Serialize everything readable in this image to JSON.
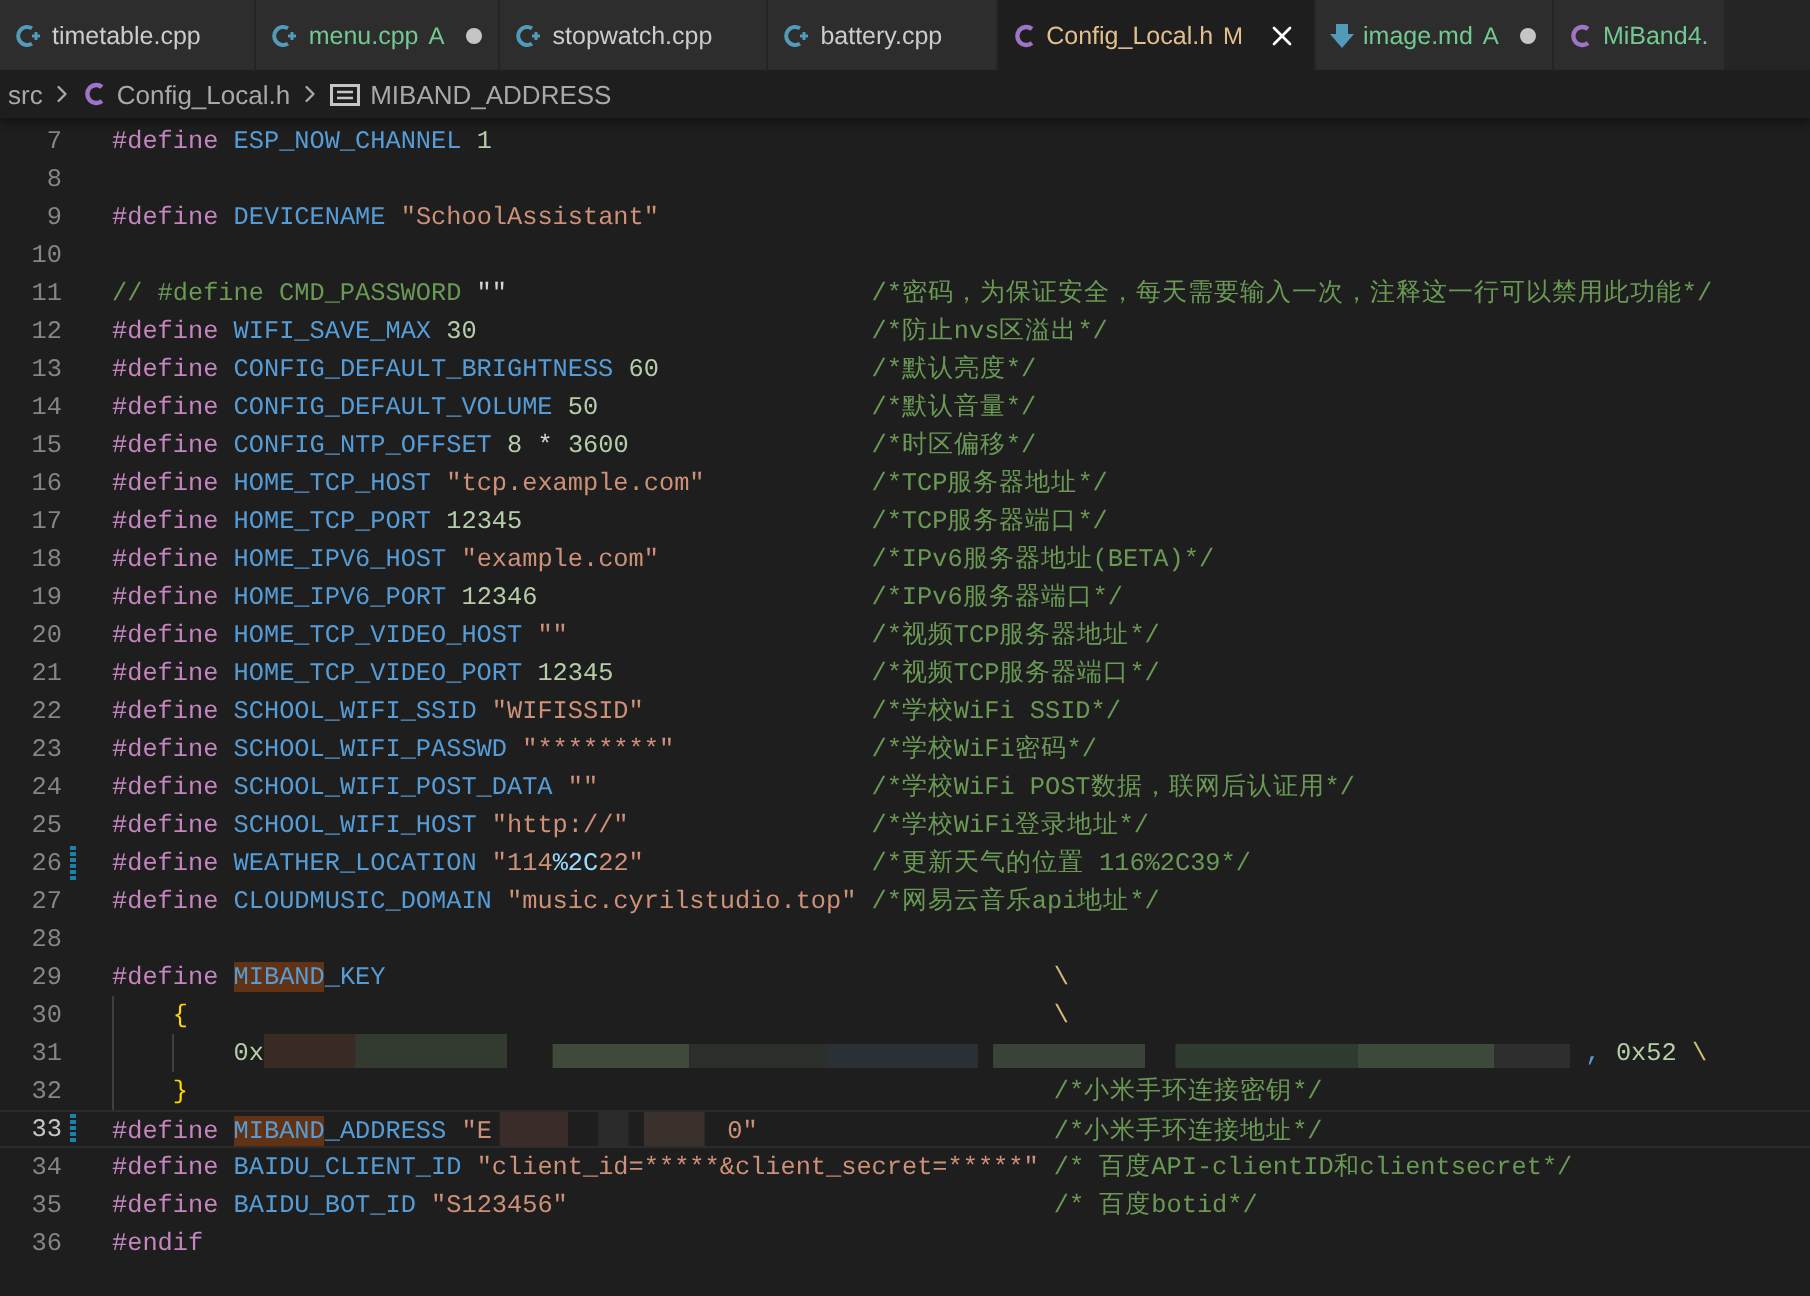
{
  "tabs": [
    {
      "label": "timetable.cpp",
      "kind": "cpp",
      "color": "#cccccc",
      "selected": false,
      "dirty": false
    },
    {
      "label": "menu.cpp",
      "kind": "cpp",
      "badge": "A",
      "color": "#73c991",
      "selected": false,
      "dirty": true
    },
    {
      "label": "stopwatch.cpp",
      "kind": "cpp",
      "color": "#cccccc",
      "selected": false,
      "dirty": false
    },
    {
      "label": "battery.cpp",
      "kind": "cpp",
      "color": "#cccccc",
      "selected": false,
      "dirty": false
    },
    {
      "label": "Config_Local.h",
      "kind": "c",
      "badge": "M",
      "color": "#e2c08d",
      "selected": true,
      "dirty": false
    },
    {
      "label": "image.md",
      "kind": "md",
      "badge": "A",
      "color": "#73c991",
      "selected": false,
      "dirty": true
    },
    {
      "label": "MiBand4.",
      "kind": "c",
      "color": "#73c991",
      "selected": false,
      "dirty": false
    }
  ],
  "breadcrumbs": [
    {
      "label": "src",
      "kind": "folder"
    },
    {
      "label": "Config_Local.h",
      "kind": "c"
    },
    {
      "label": "MIBAND_ADDRESS",
      "kind": "symbol"
    }
  ],
  "lines": [
    {
      "n": "7",
      "current": false,
      "modified": false,
      "code": [
        [
          {
            "kind": "kw",
            "text": "#define"
          }
        ],
        [
          {
            "kind": "macro",
            "text": "ESP_NOW_CHANNEL"
          }
        ],
        [
          {
            "kind": "num",
            "text": "1"
          }
        ]
      ]
    },
    {
      "n": "8",
      "current": false,
      "modified": false
    },
    {
      "n": "9",
      "current": false,
      "modified": false,
      "code": [
        [
          {
            "kind": "kw",
            "text": "#define"
          }
        ],
        [
          {
            "kind": "macro",
            "text": "DEVICENAME"
          }
        ],
        [
          {
            "kind": "str",
            "text": "\"SchoolAssistant\""
          }
        ]
      ]
    },
    {
      "n": "10",
      "current": false,
      "modified": false
    },
    {
      "n": "11",
      "current": false,
      "modified": false,
      "code": [
        [
          {
            "kind": "comment",
            "text": "// #define CMD_PASSWORD"
          }
        ],
        [
          {
            "kind": "plain",
            "text": "\"\""
          }
        ]
      ],
      "trailer": {
        "kind": "comment",
        "text": "/*密码，为保证安全，每天需要输入一次，注释这一行可以禁用此功能*/"
      }
    },
    {
      "n": "12",
      "current": false,
      "modified": false,
      "code": [
        [
          {
            "kind": "kw",
            "text": "#define"
          }
        ],
        [
          {
            "kind": "macro",
            "text": "WIFI_SAVE_MAX"
          }
        ],
        [
          {
            "kind": "num",
            "text": "30"
          }
        ]
      ],
      "trailer": {
        "kind": "comment",
        "text": "/*防止nvs区溢出*/"
      }
    },
    {
      "n": "13",
      "current": false,
      "modified": false,
      "code": [
        [
          {
            "kind": "kw",
            "text": "#define"
          }
        ],
        [
          {
            "kind": "macro",
            "text": "CONFIG_DEFAULT_BRIGHTNESS"
          }
        ],
        [
          {
            "kind": "num",
            "text": "60"
          }
        ]
      ],
      "trailer": {
        "kind": "comment",
        "text": "/*默认亮度*/"
      }
    },
    {
      "n": "14",
      "current": false,
      "modified": false,
      "code": [
        [
          {
            "kind": "kw",
            "text": "#define"
          }
        ],
        [
          {
            "kind": "macro",
            "text": "CONFIG_DEFAULT_VOLUME"
          }
        ],
        [
          {
            "kind": "num",
            "text": "50"
          }
        ]
      ],
      "trailer": {
        "kind": "comment",
        "text": "/*默认音量*/"
      }
    },
    {
      "n": "15",
      "current": false,
      "modified": false,
      "code": [
        [
          {
            "kind": "kw",
            "text": "#define"
          }
        ],
        [
          {
            "kind": "macro",
            "text": "CONFIG_NTP_OFFSET"
          }
        ],
        [
          {
            "kind": "num",
            "text": "8"
          }
        ],
        [
          {
            "kind": "op",
            "text": "*"
          }
        ],
        [
          {
            "kind": "num",
            "text": "3600"
          }
        ]
      ],
      "trailer": {
        "kind": "comment",
        "text": "/*时区偏移*/"
      }
    },
    {
      "n": "16",
      "current": false,
      "modified": false,
      "code": [
        [
          {
            "kind": "kw",
            "text": "#define"
          }
        ],
        [
          {
            "kind": "macro",
            "text": "HOME_TCP_HOST"
          }
        ],
        [
          {
            "kind": "str",
            "text": "\"tcp.example.com\""
          }
        ]
      ],
      "trailer": {
        "kind": "comment",
        "text": "/*TCP服务器地址*/"
      }
    },
    {
      "n": "17",
      "current": false,
      "modified": false,
      "code": [
        [
          {
            "kind": "kw",
            "text": "#define"
          }
        ],
        [
          {
            "kind": "macro",
            "text": "HOME_TCP_PORT"
          }
        ],
        [
          {
            "kind": "num",
            "text": "12345"
          }
        ]
      ],
      "trailer": {
        "kind": "comment",
        "text": "/*TCP服务器端口*/"
      }
    },
    {
      "n": "18",
      "current": false,
      "modified": false,
      "code": [
        [
          {
            "kind": "kw",
            "text": "#define"
          }
        ],
        [
          {
            "kind": "macro",
            "text": "HOME_IPV6_HOST"
          }
        ],
        [
          {
            "kind": "str",
            "text": "\"example.com\""
          }
        ]
      ],
      "trailer": {
        "kind": "comment",
        "text": "/*IPv6服务器地址(BETA)*/"
      }
    },
    {
      "n": "19",
      "current": false,
      "modified": false,
      "code": [
        [
          {
            "kind": "kw",
            "text": "#define"
          }
        ],
        [
          {
            "kind": "macro",
            "text": "HOME_IPV6_PORT"
          }
        ],
        [
          {
            "kind": "num",
            "text": "12346"
          }
        ]
      ],
      "trailer": {
        "kind": "comment",
        "text": "/*IPv6服务器端口*/"
      }
    },
    {
      "n": "20",
      "current": false,
      "modified": false,
      "code": [
        [
          {
            "kind": "kw",
            "text": "#define"
          }
        ],
        [
          {
            "kind": "macro",
            "text": "HOME_TCP_VIDEO_HOST"
          }
        ],
        [
          {
            "kind": "str",
            "text": "\"\""
          }
        ]
      ],
      "trailer": {
        "kind": "comment",
        "text": "/*视频TCP服务器地址*/"
      }
    },
    {
      "n": "21",
      "current": false,
      "modified": false,
      "code": [
        [
          {
            "kind": "kw",
            "text": "#define"
          }
        ],
        [
          {
            "kind": "macro",
            "text": "HOME_TCP_VIDEO_PORT"
          }
        ],
        [
          {
            "kind": "num",
            "text": "12345"
          }
        ]
      ],
      "trailer": {
        "kind": "comment",
        "text": "/*视频TCP服务器端口*/"
      }
    },
    {
      "n": "22",
      "current": false,
      "modified": false,
      "code": [
        [
          {
            "kind": "kw",
            "text": "#define"
          }
        ],
        [
          {
            "kind": "macro",
            "text": "SCHOOL_WIFI_SSID"
          }
        ],
        [
          {
            "kind": "str",
            "text": "\"WIFISSID\""
          }
        ]
      ],
      "trailer": {
        "kind": "comment",
        "text": "/*学校WiFi SSID*/"
      }
    },
    {
      "n": "23",
      "current": false,
      "modified": false,
      "code": [
        [
          {
            "kind": "kw",
            "text": "#define"
          }
        ],
        [
          {
            "kind": "macro",
            "text": "SCHOOL_WIFI_PASSWD"
          }
        ],
        [
          {
            "kind": "str",
            "text": "\"********\""
          }
        ]
      ],
      "trailer": {
        "kind": "comment",
        "text": "/*学校WiFi密码*/"
      }
    },
    {
      "n": "24",
      "current": false,
      "modified": false,
      "code": [
        [
          {
            "kind": "kw",
            "text": "#define"
          }
        ],
        [
          {
            "kind": "macro",
            "text": "SCHOOL_WIFI_POST_DATA"
          }
        ],
        [
          {
            "kind": "str",
            "text": "\"\""
          }
        ]
      ],
      "trailer": {
        "kind": "comment",
        "text": "/*学校WiFi POST数据，联网后认证用*/"
      }
    },
    {
      "n": "25",
      "current": false,
      "modified": false,
      "code": [
        [
          {
            "kind": "kw",
            "text": "#define"
          }
        ],
        [
          {
            "kind": "macro",
            "text": "SCHOOL_WIFI_HOST"
          }
        ],
        [
          {
            "kind": "str",
            "text": "\"http://\""
          }
        ]
      ],
      "trailer": {
        "kind": "comment",
        "text": "/*学校WiFi登录地址*/"
      }
    },
    {
      "n": "26",
      "current": false,
      "modified": true,
      "code": [
        [
          {
            "kind": "kw",
            "text": "#define"
          }
        ],
        [
          {
            "kind": "macro",
            "text": "WEATHER_LOCATION"
          }
        ],
        [
          {
            "kind": "str",
            "text": "\"114"
          },
          {
            "kind": "esc",
            "text": "%2C"
          },
          {
            "kind": "str",
            "text": "22\""
          }
        ]
      ],
      "trailer": {
        "kind": "comment",
        "text": "/*更新天气的位置 116%2C39*/"
      }
    },
    {
      "n": "27",
      "current": false,
      "modified": false,
      "code": [
        [
          {
            "kind": "kw",
            "text": "#define"
          }
        ],
        [
          {
            "kind": "macro",
            "text": "CLOUDMUSIC_DOMAIN"
          }
        ],
        [
          {
            "kind": "str",
            "text": "\"music.cyrilstudio.top\""
          }
        ]
      ],
      "trailer": {
        "kind": "comment",
        "text": "/*网易云音乐api地址*/"
      }
    },
    {
      "n": "28",
      "current": false,
      "modified": false
    },
    {
      "n": "29",
      "current": false,
      "modified": false,
      "code": [
        [
          {
            "kind": "kw",
            "text": "#define"
          }
        ],
        [
          {
            "kind": "match",
            "text": "MIBAND"
          },
          {
            "kind": "macro",
            "text": "_KEY"
          }
        ]
      ],
      "trailer": {
        "kind": "cont",
        "text": "\\"
      },
      "children": [
        {
          "n": "30",
          "current": false,
          "modified": false,
          "code": [
            [
              {
                "kind": "brace",
                "text": "{"
              }
            ]
          ],
          "trailer": {
            "kind": "cont",
            "text": "\\"
          },
          "children": [
            {
              "n": "31",
              "current": false,
              "modified": false,
              "code": [
                [
                  {
                    "kind": "num",
                    "text": "0x"
                  },
                  {
                    "kind": "redacted_long"
                  }
                ],
                [
                  {
                    "kind": "punct",
                    "text": ","
                  }
                ],
                [
                  {
                    "kind": "num",
                    "text": "0x52"
                  }
                ],
                [
                  {
                    "kind": "cont",
                    "text": "\\"
                  }
                ]
              ]
            }
          ]
        },
        {
          "n": "32",
          "current": false,
          "modified": false,
          "code": [
            [
              {
                "kind": "brace",
                "text": "}"
              }
            ]
          ],
          "trailer": {
            "kind": "comment",
            "text": "/*小米手环连接密钥*/"
          }
        }
      ]
    },
    {
      "n": "33",
      "current": true,
      "modified": true,
      "code": [
        [
          {
            "kind": "kw",
            "text": "#define"
          }
        ],
        [
          {
            "kind": "match",
            "text": "MIBAND"
          },
          {
            "kind": "macro",
            "text": "_ADDRESS"
          }
        ],
        [
          {
            "kind": "str",
            "text": "\"E"
          },
          {
            "kind": "redacted_short"
          },
          {
            "kind": "str",
            "text": "0\""
          }
        ]
      ],
      "trailer": {
        "kind": "comment",
        "text": "/*小米手环连接地址*/"
      }
    },
    {
      "n": "34",
      "current": false,
      "modified": false,
      "code": [
        [
          {
            "kind": "kw",
            "text": "#define"
          }
        ],
        [
          {
            "kind": "macro",
            "text": "BAIDU_CLIENT_ID"
          }
        ],
        [
          {
            "kind": "str",
            "text": "\"client_id=*****&client_secret=*****\""
          }
        ]
      ],
      "trailer": {
        "kind": "comment",
        "text": "/* 百度API-clientID和clientsecret*/"
      }
    },
    {
      "n": "35",
      "current": false,
      "modified": false,
      "code": [
        [
          {
            "kind": "kw",
            "text": "#define"
          }
        ],
        [
          {
            "kind": "macro",
            "text": "BAIDU_BOT_ID"
          }
        ],
        [
          {
            "kind": "str",
            "text": "\"S123456\""
          }
        ]
      ],
      "trailer": {
        "kind": "comment",
        "text": "/* 百度botid*/"
      }
    },
    {
      "n": "36",
      "current": false,
      "modified": false,
      "code": [
        [
          {
            "kind": "kw",
            "text": "#endif"
          }
        ]
      ]
    }
  ]
}
